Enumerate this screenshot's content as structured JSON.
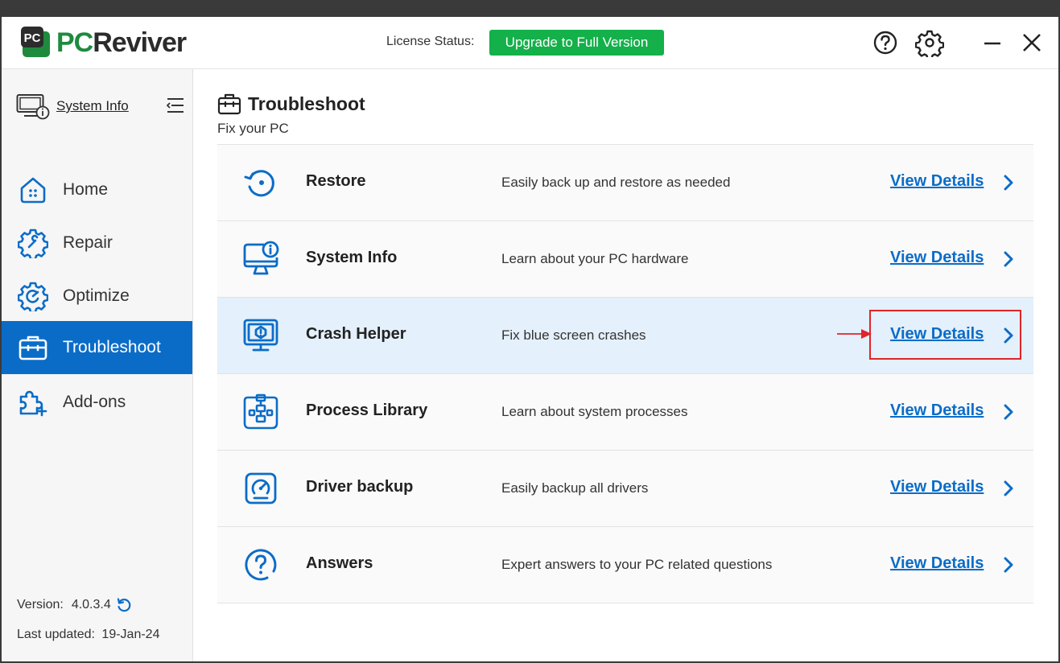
{
  "app": {
    "name_pc": "PC",
    "name_rest": "Reviver",
    "badge": "PC",
    "license_label": "License Status:",
    "upgrade_label": "Upgrade to Full Version",
    "brand_green": "#1f8a3d",
    "accent_blue": "#0b6cc8",
    "button_green": "#14b04a"
  },
  "titlebar": {
    "icons": [
      "help-icon",
      "gear-icon",
      "minimize-icon",
      "close-icon"
    ]
  },
  "sidebar": {
    "system_info_label": "System Info",
    "items": [
      {
        "label": "Home",
        "icon": "home-icon",
        "active": false
      },
      {
        "label": "Repair",
        "icon": "repair-gear-icon",
        "active": false
      },
      {
        "label": "Optimize",
        "icon": "optimize-gear-icon",
        "active": false
      },
      {
        "label": "Troubleshoot",
        "icon": "toolbox-icon",
        "active": true
      },
      {
        "label": "Add-ons",
        "icon": "puzzle-icon",
        "active": false
      }
    ],
    "version_label": "Version:",
    "version_value": "4.0.3.4",
    "last_updated_label": "Last updated:",
    "last_updated_value": "19-Jan-24"
  },
  "main": {
    "title": "Troubleshoot",
    "subtitle": "Fix your PC",
    "rows": [
      {
        "name": "Restore",
        "desc": "Easily back up and restore as needed",
        "link": "View Details",
        "icon": "restore-icon"
      },
      {
        "name": "System Info",
        "desc": "Learn about your PC hardware",
        "link": "View Details",
        "icon": "monitor-info-icon"
      },
      {
        "name": "Crash Helper",
        "desc": "Fix blue screen crashes",
        "link": "View Details",
        "icon": "monitor-alert-icon"
      },
      {
        "name": "Process Library",
        "desc": "Learn about system processes",
        "link": "View Details",
        "icon": "process-library-icon"
      },
      {
        "name": "Driver backup",
        "desc": "Easily backup all drivers",
        "link": "View Details",
        "icon": "driver-backup-icon"
      },
      {
        "name": "Answers",
        "desc": "Expert answers to your PC related questions",
        "link": "View Details",
        "icon": "question-icon"
      }
    ]
  }
}
